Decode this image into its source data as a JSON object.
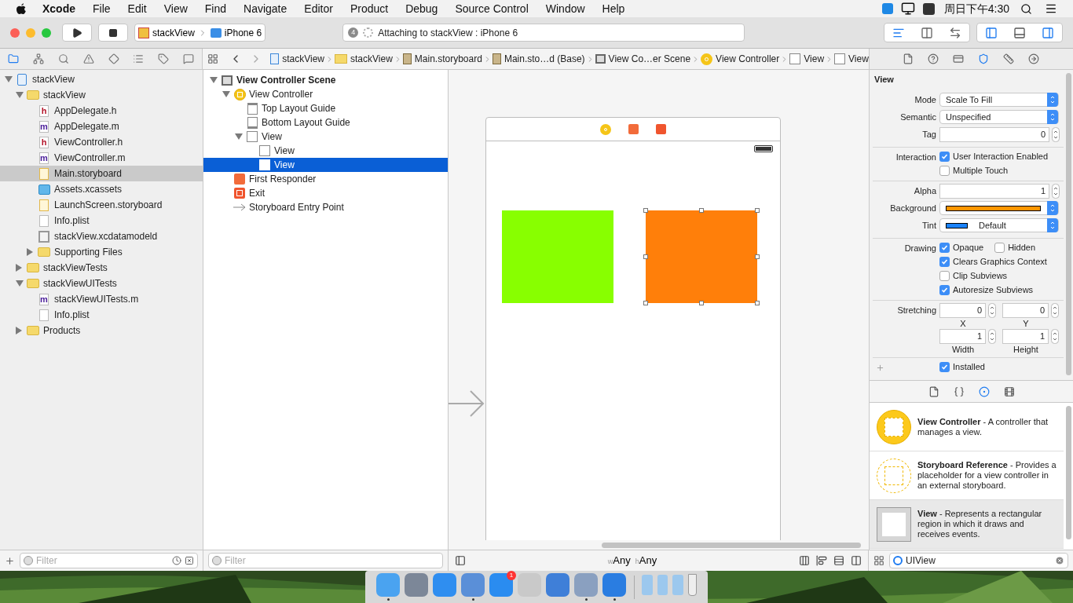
{
  "menubar": {
    "app": "Xcode",
    "items": [
      "File",
      "Edit",
      "View",
      "Find",
      "Navigate",
      "Editor",
      "Product",
      "Debug",
      "Source Control",
      "Window",
      "Help"
    ],
    "clock": "周日下午4:30"
  },
  "toolbar": {
    "scheme": "stackView",
    "device": "iPhone 6",
    "activity": {
      "badge": "4",
      "text": "Attaching to stackView : iPhone 6"
    },
    "editor_modes": [
      {
        "selected": true
      },
      {
        "selected": false
      },
      {
        "selected": false
      }
    ],
    "panels": [
      {
        "on": true
      },
      {
        "on": false
      },
      {
        "on": true
      }
    ]
  },
  "navigator_tabs": [
    {
      "selected": true
    },
    {
      "selected": false
    },
    {
      "selected": false
    },
    {
      "selected": false
    },
    {
      "selected": false
    },
    {
      "selected": false
    },
    {
      "selected": false
    },
    {
      "selected": false
    }
  ],
  "jump_bar": [
    {
      "label": "stackView",
      "kind": "project"
    },
    {
      "label": "stackView",
      "kind": "folder"
    },
    {
      "label": "Main.storyboard",
      "kind": "storyboard_file"
    },
    {
      "label": "Main.sto…d (Base)",
      "kind": "storyboard_file"
    },
    {
      "label": "View Co…er Scene",
      "kind": "scene"
    },
    {
      "label": "View Controller",
      "kind": "view_controller"
    },
    {
      "label": "View",
      "kind": "view"
    },
    {
      "label": "View",
      "kind": "view"
    }
  ],
  "inspector_tabs": [
    {
      "selected": false
    },
    {
      "selected": false
    },
    {
      "selected": false
    },
    {
      "selected": true
    },
    {
      "selected": false
    },
    {
      "selected": false
    }
  ],
  "navigator": {
    "tree": [
      {
        "label": "stackView",
        "kind": "project",
        "selected": false,
        "expanded": true,
        "children": [
          {
            "label": "stackView",
            "kind": "folder",
            "selected": false,
            "expanded": true,
            "children": [
              {
                "label": "AppDelegate.h",
                "kind": "header",
                "icon_text": "h",
                "selected": false
              },
              {
                "label": "AppDelegate.m",
                "kind": "source",
                "icon_text": "m",
                "selected": false
              },
              {
                "label": "ViewController.h",
                "kind": "header",
                "icon_text": "h",
                "selected": false
              },
              {
                "label": "ViewController.m",
                "kind": "source",
                "icon_text": "m",
                "selected": false
              },
              {
                "label": "Main.storyboard",
                "kind": "storyboard",
                "selected": true
              },
              {
                "label": "Assets.xcassets",
                "kind": "assets",
                "selected": false
              },
              {
                "label": "LaunchScreen.storyboard",
                "kind": "storyboard",
                "selected": false
              },
              {
                "label": "Info.plist",
                "kind": "plist",
                "selected": false
              },
              {
                "label": "stackView.xcdatamodeld",
                "kind": "datamodel",
                "selected": false
              },
              {
                "label": "Supporting Files",
                "kind": "folder",
                "selected": false,
                "expanded": false
              }
            ]
          },
          {
            "label": "stackViewTests",
            "kind": "folder",
            "selected": false,
            "expanded": false
          },
          {
            "label": "stackViewUITests",
            "kind": "folder",
            "selected": false,
            "expanded": true,
            "children": [
              {
                "label": "stackViewUITests.m",
                "kind": "source",
                "icon_text": "m",
                "selected": false
              },
              {
                "label": "Info.plist",
                "kind": "plist",
                "selected": false
              }
            ]
          },
          {
            "label": "Products",
            "kind": "folder",
            "selected": false,
            "expanded": false
          }
        ]
      }
    ],
    "filter": {
      "placeholder": "Filter"
    }
  },
  "outline": {
    "tree": [
      {
        "label": "View Controller Scene",
        "kind": "scene",
        "selected": false,
        "expanded": true,
        "children": [
          {
            "label": "View Controller",
            "kind": "view_controller",
            "selected": false,
            "expanded": true,
            "children": [
              {
                "label": "Top Layout Guide",
                "kind": "top_guide",
                "selected": false
              },
              {
                "label": "Bottom Layout Guide",
                "kind": "bottom_guide",
                "selected": false
              },
              {
                "label": "View",
                "kind": "view",
                "selected": false,
                "expanded": true,
                "children": [
                  {
                    "label": "View",
                    "kind": "view",
                    "selected": false
                  },
                  {
                    "label": "View",
                    "kind": "view",
                    "selected": true
                  }
                ]
              }
            ]
          },
          {
            "label": "First Responder",
            "kind": "first_responder",
            "selected": false
          },
          {
            "label": "Exit",
            "kind": "exit",
            "selected": false
          },
          {
            "label": "Storyboard Entry Point",
            "kind": "entry_point",
            "selected": false
          }
        ]
      }
    ],
    "filter": {
      "placeholder": "Filter"
    }
  },
  "canvas": {
    "views": [
      {
        "color": "#88ff00",
        "selected": false
      },
      {
        "color": "#ff7f0a",
        "selected": true
      }
    ],
    "size_class": [
      {
        "prefix": "w",
        "value": "Any"
      },
      {
        "prefix": "h",
        "value": "Any"
      }
    ]
  },
  "inspector": {
    "title": "View",
    "groups": [
      {
        "rows": [
          {
            "kind": "popup",
            "label": "Mode",
            "value": "Scale To Fill"
          },
          {
            "kind": "popup",
            "label": "Semantic",
            "value": "Unspecified"
          },
          {
            "kind": "number",
            "label": "Tag",
            "value": "0"
          }
        ]
      },
      {
        "rows": [
          {
            "kind": "checks",
            "label": "Interaction",
            "items": [
              {
                "text": "User Interaction Enabled",
                "checked": true
              }
            ]
          },
          {
            "kind": "checks",
            "items": [
              {
                "text": "Multiple Touch",
                "checked": false
              }
            ]
          }
        ]
      },
      {
        "rows": [
          {
            "kind": "number",
            "label": "Alpha",
            "value": "1"
          },
          {
            "kind": "color",
            "label": "Background",
            "color": "#ff9500"
          },
          {
            "kind": "color_popup",
            "label": "Tint",
            "color": "#1a82fb",
            "value": "Default"
          }
        ]
      },
      {
        "rows": [
          {
            "kind": "checks",
            "label": "Drawing",
            "items": [
              {
                "text": "Opaque",
                "checked": true
              },
              {
                "text": "Hidden",
                "checked": false
              }
            ]
          },
          {
            "kind": "checks",
            "items": [
              {
                "text": "Clears Graphics Context",
                "checked": true
              }
            ]
          },
          {
            "kind": "checks",
            "items": [
              {
                "text": "Clip Subviews",
                "checked": false
              }
            ]
          },
          {
            "kind": "checks",
            "items": [
              {
                "text": "Autoresize Subviews",
                "checked": true
              }
            ]
          }
        ]
      },
      {
        "rows": [
          {
            "kind": "pair",
            "label": "Stretching",
            "fields": [
              {
                "value": "0",
                "caption": "X"
              },
              {
                "value": "0",
                "caption": "Y"
              }
            ]
          },
          {
            "kind": "pair",
            "fields": [
              {
                "value": "1",
                "caption": "Width"
              },
              {
                "value": "1",
                "caption": "Height"
              }
            ]
          }
        ]
      },
      {
        "rows": [
          {
            "kind": "checks",
            "plus": true,
            "items": [
              {
                "text": "Installed",
                "checked": true
              }
            ]
          }
        ]
      }
    ]
  },
  "library": {
    "tabs": [
      {
        "selected": false
      },
      {
        "selected": false
      },
      {
        "selected": true
      },
      {
        "selected": false
      }
    ],
    "items": [
      {
        "kind": "view_controller",
        "text": "**View Controller** - A controller that manages a view.",
        "selected": false
      },
      {
        "kind": "storyboard_reference",
        "text": "**Storyboard Reference** - Provides a placeholder for a view controller in an external storyboard.",
        "selected": false
      },
      {
        "kind": "view",
        "text": "**View** - Represents a rectangular region in which it draws and receives events.",
        "selected": true
      }
    ],
    "filter": {
      "value": "UIView"
    }
  },
  "dock": {
    "apps": [
      {
        "running": true
      },
      {
        "running": false
      },
      {
        "running": false
      },
      {
        "running": true
      },
      {
        "running": false,
        "badge": "1"
      },
      {
        "running": false
      },
      {
        "running": false
      },
      {
        "running": true
      },
      {
        "running": true
      }
    ]
  }
}
